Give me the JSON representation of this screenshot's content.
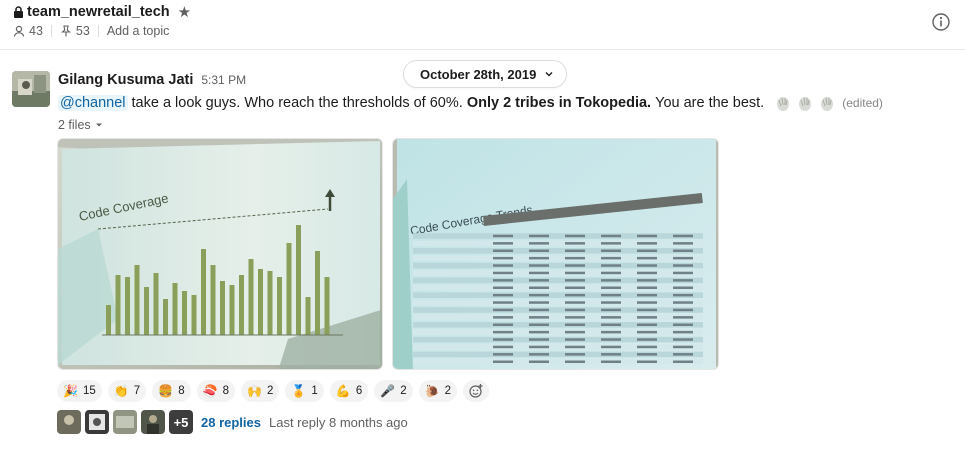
{
  "channel": {
    "name": "team_newretail_tech",
    "member_count": "43",
    "pinned_count": "53",
    "add_topic_label": "Add a topic"
  },
  "divider": {
    "date_label": "October 28th, 2019"
  },
  "message": {
    "sender": "Gilang Kusuma Jati",
    "time": "5:31 PM",
    "mention": "@channel",
    "text_part1": "take a look guys. Who reach the thresholds of 60%.",
    "text_bold": "Only 2 tribes in Tokopedia.",
    "text_part2": "You are the best.",
    "edited_label": "(edited)",
    "files_label": "2 files",
    "attachment_titles": [
      "Code Coverage",
      "Code Coverage Trends"
    ]
  },
  "reactions": [
    {
      "icon": "party-popper-icon",
      "count": "15"
    },
    {
      "icon": "clapping-icon",
      "count": "7"
    },
    {
      "icon": "burger-icon",
      "count": "8"
    },
    {
      "icon": "sushi-icon",
      "count": "8"
    },
    {
      "icon": "clap-hands-icon",
      "count": "2"
    },
    {
      "icon": "medal-icon",
      "count": "1"
    },
    {
      "icon": "muscle-icon",
      "count": "6"
    },
    {
      "icon": "microphone-icon",
      "count": "2"
    },
    {
      "icon": "snail-icon",
      "count": "2"
    }
  ],
  "thread": {
    "more_label": "+5",
    "replies_label": "28 replies",
    "last_reply_label": "Last reply 8 months ago"
  },
  "colors": {
    "link": "#1264a3",
    "mention_bg": "#e8f5fa",
    "muted": "#616061",
    "chart_bar": "#8aa05a"
  }
}
